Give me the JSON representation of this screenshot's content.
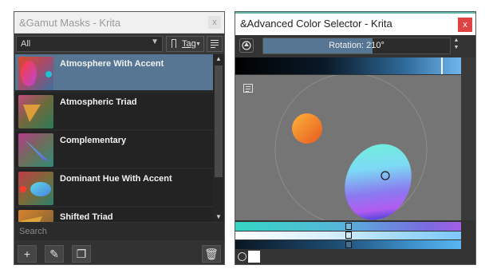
{
  "gamut_window": {
    "title": "&Gamut Masks - Krita",
    "close_label": "x",
    "filter": {
      "selected": "All"
    },
    "tag_button_label": "Tag",
    "items": [
      {
        "label": "Atmosphere With Accent",
        "selected": true
      },
      {
        "label": "Atmospheric Triad",
        "selected": false
      },
      {
        "label": "Complementary",
        "selected": false
      },
      {
        "label": "Dominant Hue With Accent",
        "selected": false
      },
      {
        "label": "Shifted Triad",
        "selected": false
      }
    ],
    "search_placeholder": "Search",
    "bottom_buttons": [
      "add-icon",
      "edit-icon",
      "duplicate-icon",
      "delete-icon"
    ]
  },
  "color_window": {
    "title": "&Advanced Color Selector - Krita",
    "close_label": "x",
    "rotation_text": "Rotation: 210°",
    "rotation_value_deg": 210,
    "colors": {
      "selected_hue": "#3fb8e8",
      "highlight": "#567693",
      "close_red": "#e04343",
      "accent_teal": "#5fb8a7"
    }
  }
}
